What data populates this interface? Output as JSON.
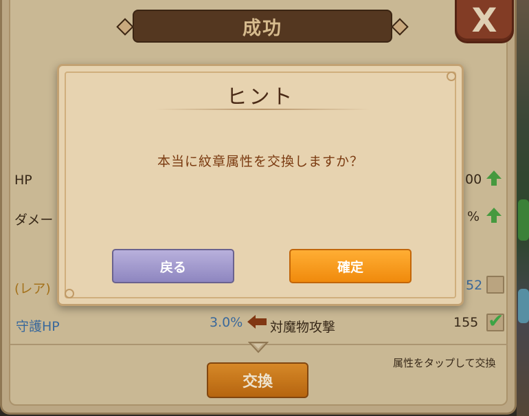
{
  "screen": {
    "title": "成功",
    "close_label": "X",
    "exchange_button": "交換",
    "tap_hint": "属性をタップして交換"
  },
  "stats": [
    {
      "label": "HP",
      "value_partial": "00"
    },
    {
      "label": "ダメー",
      "value_partial": "%"
    },
    {
      "label": "(レア)",
      "value_partial": "52"
    }
  ],
  "exchange_row": {
    "left_label": "守護HP",
    "left_value": "3.0%",
    "right_label": "対魔物攻撃",
    "right_value": "155"
  },
  "dialog": {
    "title": "ヒント",
    "message": "本当に紋章属性を交換しますか？",
    "back_label": "戻る",
    "confirm_label": "確定"
  },
  "colors": {
    "confirm": "#f39a1a",
    "back": "#a69ed0",
    "title_text": "#4a2a16",
    "message_text": "#7a3a10"
  }
}
